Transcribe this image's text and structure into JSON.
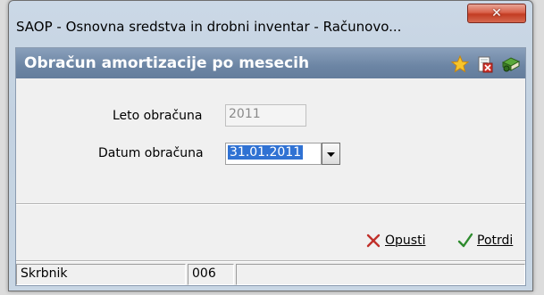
{
  "window": {
    "title": "SAOP -  Osnovna sredstva in drobni inventar - Računovo...",
    "close_glyph": "✕"
  },
  "header": {
    "title": "Obračun amortizacije po mesecih",
    "icons": [
      "star-icon",
      "delete-document-icon",
      "book-icon"
    ]
  },
  "form": {
    "year_label": "Leto obračuna",
    "year_value": "2011",
    "date_label": "Datum obračuna",
    "date_value": "31.01.2011"
  },
  "actions": {
    "cancel_label": "Opusti",
    "confirm_label": "Potrdi"
  },
  "status": {
    "user_label": "Skrbnik",
    "code": "006",
    "extra": ""
  },
  "colors": {
    "header_bar": "#6c85a4",
    "selection": "#3072d3",
    "cancel_x": "#c0302a",
    "confirm_check": "#2e8b2e"
  }
}
